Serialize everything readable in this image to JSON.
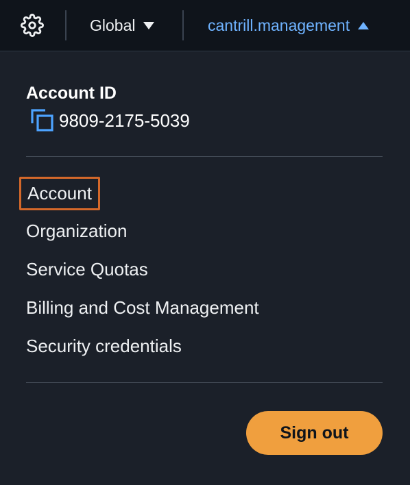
{
  "header": {
    "settings_icon": "gear-icon",
    "region_label": "Global",
    "account_menu_label": "cantrill.management"
  },
  "account": {
    "id_label": "Account ID",
    "id_value": "9809-2175-5039",
    "copy_icon": "copy-icon"
  },
  "menu": {
    "items": [
      {
        "label": "Account"
      },
      {
        "label": "Organization"
      },
      {
        "label": "Service Quotas"
      },
      {
        "label": "Billing and Cost Management"
      },
      {
        "label": "Security credentials"
      }
    ]
  },
  "footer": {
    "sign_out_label": "Sign out"
  },
  "colors": {
    "background": "#1b2029",
    "topbar": "#0f141b",
    "link": "#6fb3ff",
    "highlight_border": "#d4682a",
    "signout": "#f09f3e"
  }
}
